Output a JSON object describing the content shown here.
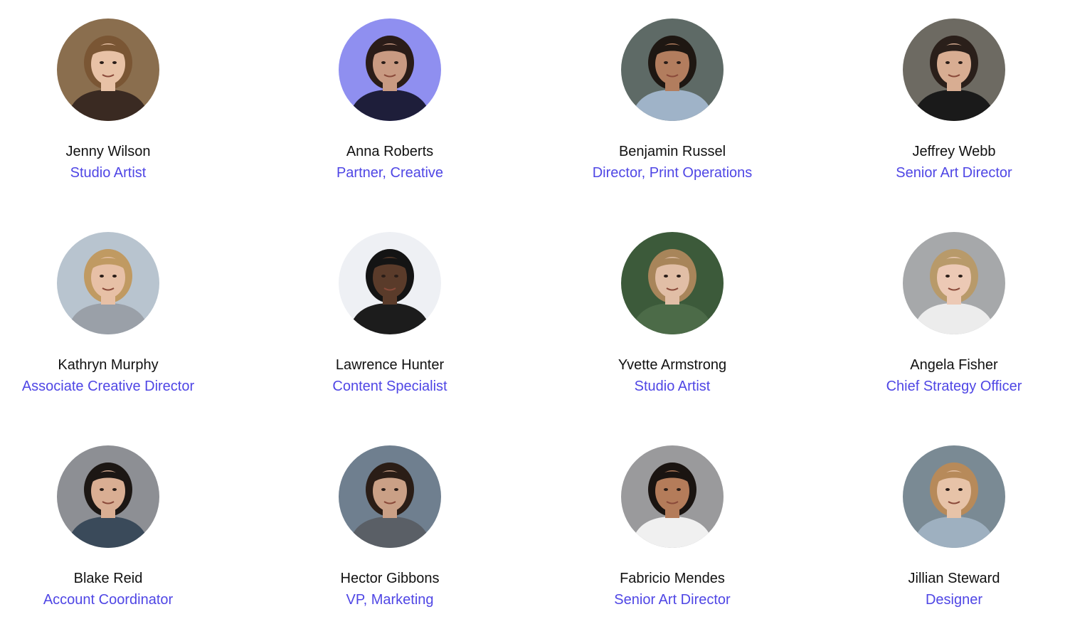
{
  "team": {
    "members": [
      {
        "name": "Jenny Wilson",
        "title": "Studio Artist",
        "photo": {
          "bg": "#8a6e4e",
          "skin": "#e8c2a6",
          "hair": "#7a5634",
          "shirt": "#3a2a22"
        }
      },
      {
        "name": "Anna Roberts",
        "title": "Partner, Creative",
        "photo": {
          "bg": "#8f8ff0",
          "skin": "#c99a82",
          "hair": "#2a1c18",
          "shirt": "#1e1e3a"
        }
      },
      {
        "name": "Benjamin Russel",
        "title": "Director, Print Operations",
        "photo": {
          "bg": "#5e6a66",
          "skin": "#b27d5e",
          "hair": "#1e1712",
          "shirt": "#9fb3c8"
        }
      },
      {
        "name": "Jeffrey Webb",
        "title": "Senior Art Director",
        "photo": {
          "bg": "#6d6a62",
          "skin": "#d8ad92",
          "hair": "#2a1f1a",
          "shirt": "#1a1a1a"
        }
      },
      {
        "name": "Kathryn Murphy",
        "title": "Associate Creative Director",
        "photo": {
          "bg": "#b8c4cf",
          "skin": "#e7c0a6",
          "hair": "#c09a62",
          "shirt": "#9aa0a8"
        }
      },
      {
        "name": "Lawrence Hunter",
        "title": "Content Specialist",
        "photo": {
          "bg": "#eef0f4",
          "skin": "#5a3b2a",
          "hair": "#141414",
          "shirt": "#1c1c1c"
        }
      },
      {
        "name": "Yvette Armstrong",
        "title": "Studio Artist",
        "photo": {
          "bg": "#3c5a3a",
          "skin": "#e1bea6",
          "hair": "#a8855a",
          "shirt": "#4c6b48"
        }
      },
      {
        "name": "Angela Fisher",
        "title": "Chief Strategy Officer",
        "photo": {
          "bg": "#a6a8aa",
          "skin": "#ecc9b5",
          "hair": "#b89a6a",
          "shirt": "#ececec"
        }
      },
      {
        "name": "Blake Reid",
        "title": "Account Coordinator",
        "photo": {
          "bg": "#8d8f94",
          "skin": "#d9ae93",
          "hair": "#1c1714",
          "shirt": "#3a4a5a"
        }
      },
      {
        "name": "Hector Gibbons",
        "title": "VP, Marketing",
        "photo": {
          "bg": "#6f7f8f",
          "skin": "#caa086",
          "hair": "#2a1d16",
          "shirt": "#5a5f66"
        }
      },
      {
        "name": "Fabricio Mendes",
        "title": "Senior Art Director",
        "photo": {
          "bg": "#9a9a9c",
          "skin": "#b47c5a",
          "hair": "#1a1411",
          "shirt": "#f0f0f0"
        }
      },
      {
        "name": "Jillian Steward",
        "title": "Designer",
        "photo": {
          "bg": "#7a8a94",
          "skin": "#e7c3a8",
          "hair": "#b78a5a",
          "shirt": "#9eb0c0"
        }
      }
    ]
  }
}
